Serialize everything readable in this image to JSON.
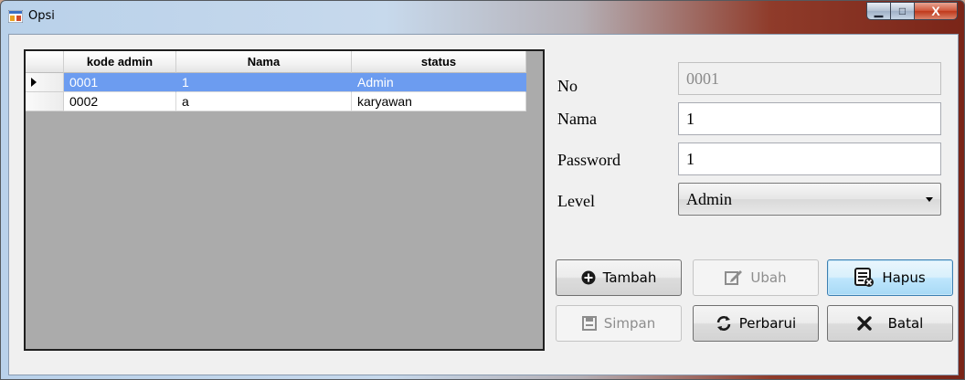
{
  "window": {
    "title": "Opsi",
    "minimize_glyph": "▁",
    "maximize_glyph": "□",
    "close_glyph": "X"
  },
  "grid": {
    "columns": [
      "kode admin",
      "Nama",
      "status"
    ],
    "rows": [
      {
        "kode": "0001",
        "nama": "1",
        "status": "Admin",
        "selected": true
      },
      {
        "kode": "0002",
        "nama": "a",
        "status": "karyawan",
        "selected": false
      }
    ]
  },
  "form": {
    "no_label": "No",
    "no_value": "0001",
    "nama_label": "Nama",
    "nama_value": "1",
    "password_label": "Password",
    "password_value": "1",
    "level_label": "Level",
    "level_value": "Admin"
  },
  "buttons": {
    "tambah": "Tambah",
    "ubah": "Ubah",
    "hapus": "Hapus",
    "simpan": "Simpan",
    "perbarui": "Perbarui",
    "batal": "Batal"
  },
  "icons": {
    "tambah": "plus-circle-icon",
    "ubah": "edit-icon",
    "hapus": "delete-list-icon",
    "simpan": "save-icon",
    "perbarui": "refresh-icon",
    "batal": "close-x-icon"
  },
  "colors": {
    "selection": "#6c9cf0",
    "grid_background": "#ababab",
    "close_button": "#c0391b"
  }
}
